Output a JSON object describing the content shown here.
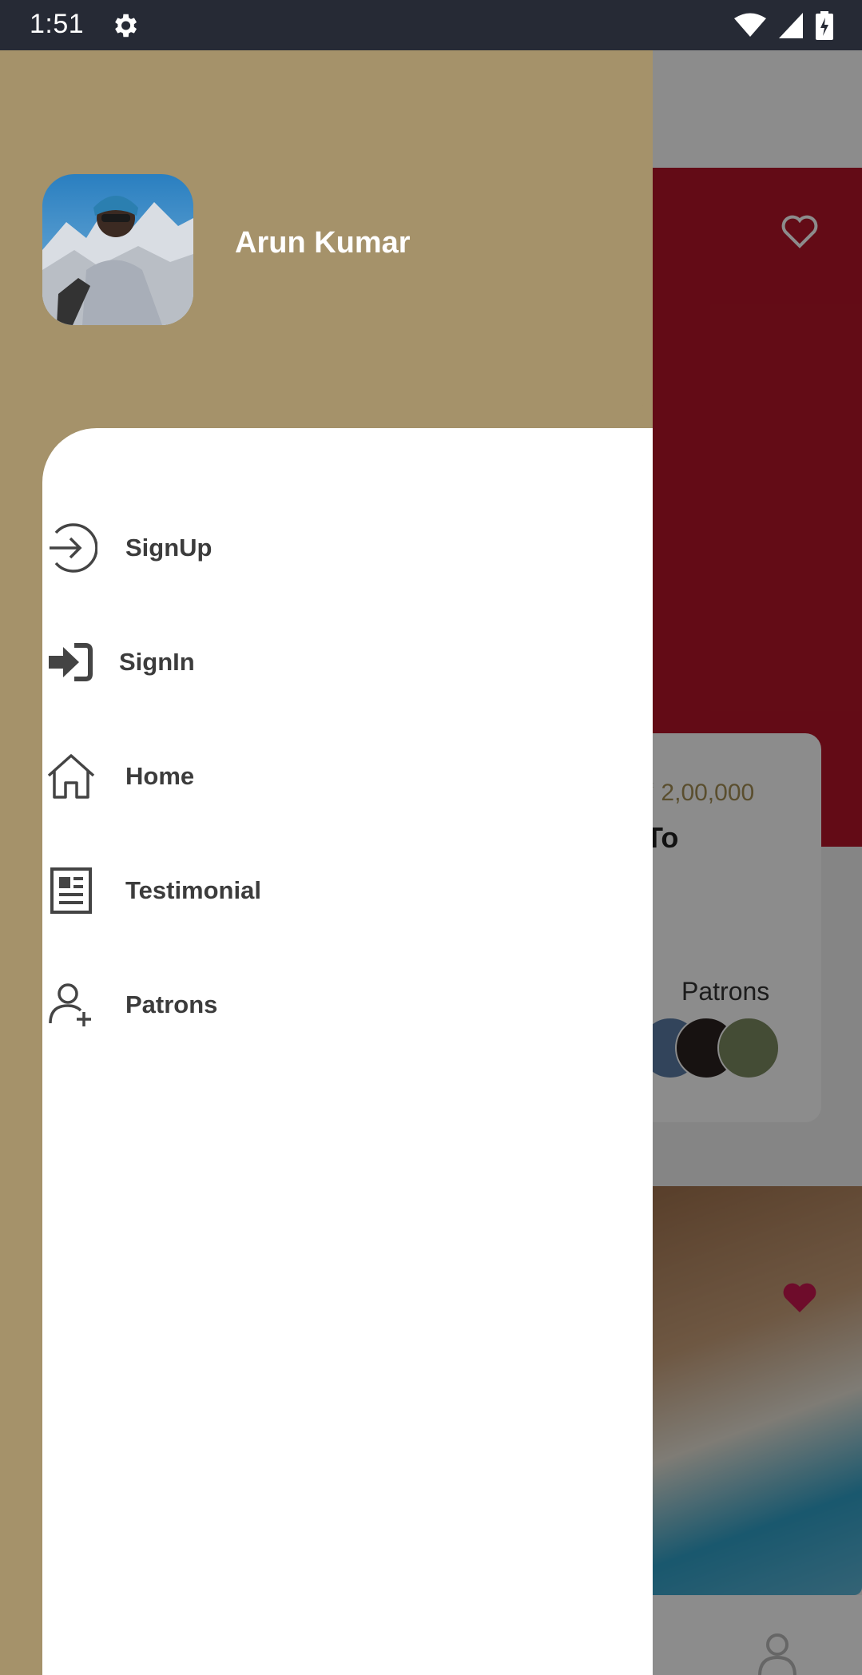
{
  "status_bar": {
    "time": "1:51"
  },
  "drawer": {
    "user_name": "Arun Kumar",
    "menu": [
      {
        "label": "SignUp",
        "icon": "arrow-right-circle-icon"
      },
      {
        "label": "SignIn",
        "icon": "sign-in-icon"
      },
      {
        "label": "Home",
        "icon": "home-icon"
      },
      {
        "label": "Testimonial",
        "icon": "newspaper-icon"
      },
      {
        "label": "Patrons",
        "icon": "add-user-icon"
      }
    ]
  },
  "background": {
    "card": {
      "amount": "₹ 2,00,000",
      "title_fragment": "To",
      "patrons_label": "Patrons"
    }
  },
  "colors": {
    "drawer_brown": "#a5926a",
    "hero_red": "#b41528",
    "heart_pink": "#c8174f",
    "status_bar": "#262a35"
  }
}
